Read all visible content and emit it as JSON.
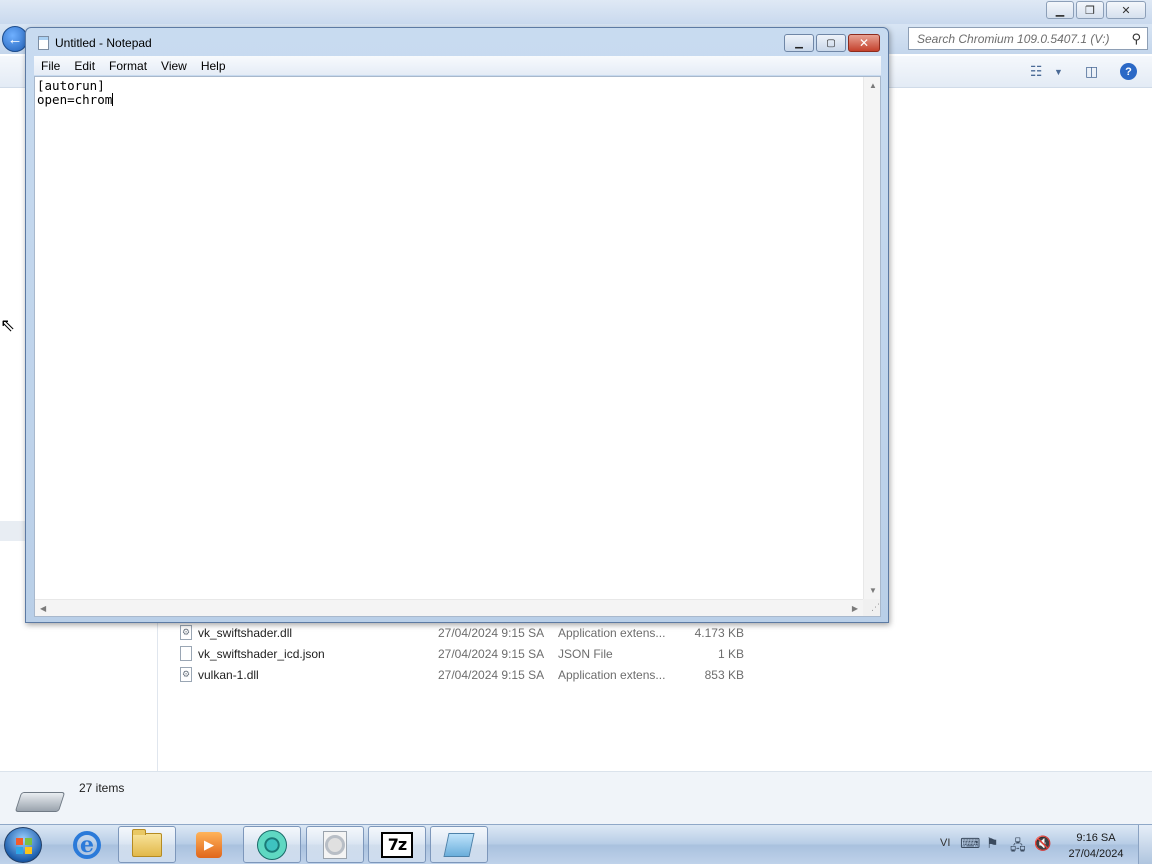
{
  "explorer": {
    "search_placeholder": "Search Chromium 109.0.5407.1 (V:)",
    "files": [
      {
        "name": "vk_swiftshader.dll",
        "date": "27/04/2024 9:15 SA",
        "type": "Application extens...",
        "size": "4.173 KB",
        "icon": "dll-file-icon"
      },
      {
        "name": "vk_swiftshader_icd.json",
        "date": "27/04/2024 9:15 SA",
        "type": "JSON File",
        "size": "1 KB",
        "icon": "json-file-icon"
      },
      {
        "name": "vulkan-1.dll",
        "date": "27/04/2024 9:15 SA",
        "type": "Application extens...",
        "size": "853 KB",
        "icon": "dll-file-icon"
      }
    ],
    "item_count": "27 items"
  },
  "notepad": {
    "title": "Untitled - Notepad",
    "menu": [
      "File",
      "Edit",
      "Format",
      "View",
      "Help"
    ],
    "content_lines": [
      "[autorun]",
      "open=chrom"
    ]
  },
  "taskbar": {
    "language": "VI",
    "time": "9:16 SA",
    "date": "27/04/2024",
    "sevenzip_label": "7z",
    "pinned": [
      "internet-explorer",
      "windows-explorer",
      "media-player",
      "chromium",
      "disc-image",
      "7-zip",
      "notepad"
    ]
  }
}
